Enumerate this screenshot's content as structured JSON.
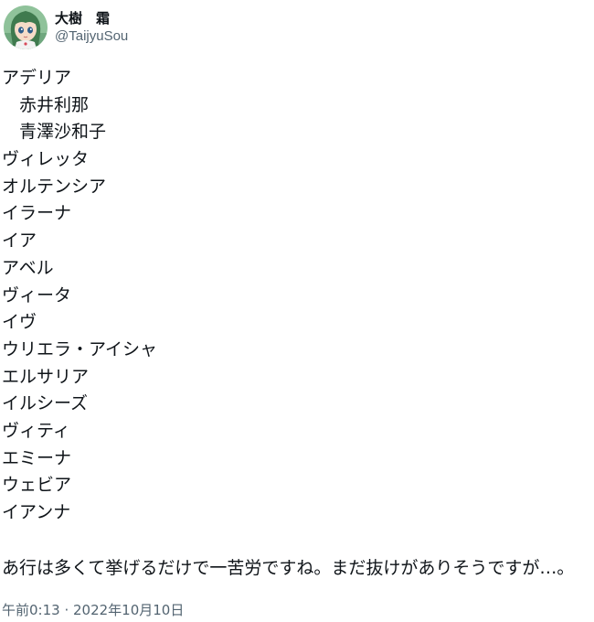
{
  "author": {
    "display_name": "大樹　霜",
    "handle": "@TaijyuSou",
    "avatar_icon": "anime-girl-avatar"
  },
  "tweet": {
    "lines": [
      "アデリア",
      "　赤井利那",
      "　青澤沙和子",
      "ヴィレッタ",
      "オルテンシア",
      "イラーナ",
      "イア",
      "アベル",
      "ヴィータ",
      "イヴ",
      "ウリエラ・アイシャ",
      "エルサリア",
      "イルシーズ",
      "ヴィティ",
      "エミーナ",
      "ウェビア",
      "イアンナ"
    ],
    "closing": "あ行は多くて挙げるだけで一苦労ですね。まだ抜けがありそうですが…。",
    "timestamp": "午前0:13 · 2022年10月10日"
  },
  "colors": {
    "text": "#0f1419",
    "secondary": "#536471",
    "avatar_bg": "#7fb08a",
    "avatar_hair": "#3f7a4e"
  }
}
